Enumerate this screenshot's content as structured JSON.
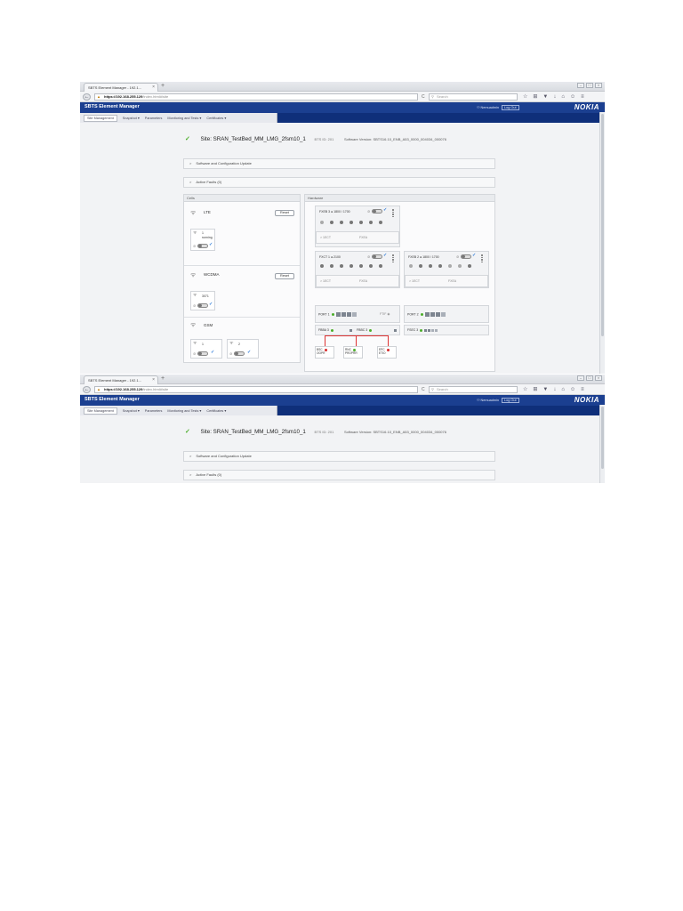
{
  "browser": {
    "tab_title": "SBTS Element Manager - 192.1...",
    "tab_close": "×",
    "new_tab": "+",
    "win_controls": [
      "–",
      "□",
      "×"
    ],
    "url_host": "https://192.168.255.129",
    "url_path": "/index.html#/site",
    "search_placeholder": "Search",
    "back_glyph": "←",
    "reload_glyph": "C",
    "nav_icons": [
      "☆",
      "⊞",
      "▼",
      "↓",
      "⌂",
      "☺",
      "≡"
    ]
  },
  "app": {
    "title": "SBTS Element Manager",
    "user": "Nemuadmin",
    "logout": "Log Out",
    "logo": "NOKIA",
    "menu": [
      "Site Management",
      "Snapshot ▾",
      "Parameters",
      "Monitoring and Tests ▾",
      "Certificates ▾"
    ]
  },
  "site": {
    "check": "✓",
    "name": "Site: SRAN_TestBed_MM_LMG_2fsm10_1",
    "bts_id": "BTS ID: 201",
    "software": "Software Version: SBTS16.10_ENB_A53_0000_004034_000076"
  },
  "accordions": {
    "chevron": ">",
    "sw_update": "Software and Configuration Update",
    "active_faults": "Active Faults (0)"
  },
  "cells": {
    "header": "Cells",
    "lte": {
      "name": "LTE",
      "reset": "Reset",
      "sub_id": "1",
      "sub_status": "running"
    },
    "wcdma": {
      "name": "WCDMA",
      "reset": "Reset",
      "sub_id": "3071"
    },
    "gsm": {
      "name": "GSM",
      "sub1_id": "1",
      "sub2_id": "2"
    }
  },
  "hardware": {
    "header": "Hardware",
    "fxeb": "FXEB 3  ●  1800 / 1700",
    "fxct": "FXCT 1  ●  2100",
    "fxeb2": "FXEB 2  ●  1800 / 1700",
    "sub_a": ">   1ECT",
    "sub_b": "FXEA",
    "port1": "PORT 1",
    "ftif": "FTIF",
    "port2": "PORT 2",
    "fbba": "FBBA 3",
    "fbbc": "FBBC 3",
    "fsec": "FSEC 3",
    "bsc": {
      "label": "BSC",
      "sub": "OOPR"
    },
    "rnc": {
      "label": "RNC",
      "sub": "PROPRR"
    },
    "epc": {
      "label": "EPC",
      "sub": "ETIO"
    }
  },
  "colors": {
    "header_blue": "#1b3f90",
    "menu_blue": "#0f2f7a",
    "ok_green": "#4cae2b",
    "alert_red": "#d92b2b"
  }
}
